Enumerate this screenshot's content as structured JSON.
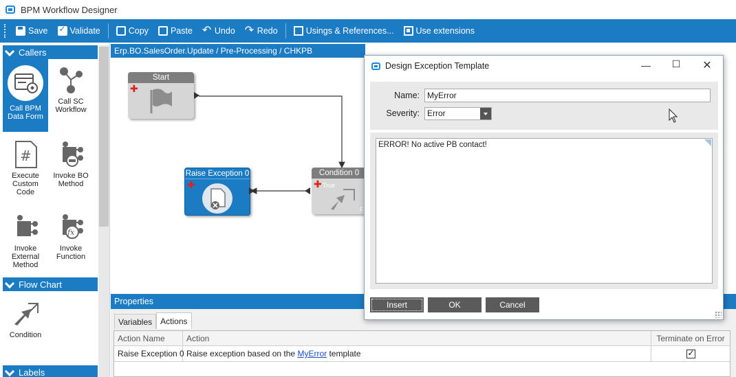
{
  "window": {
    "title": "BPM Workflow Designer"
  },
  "toolbar": {
    "save": "Save",
    "validate": "Validate",
    "copy": "Copy",
    "paste": "Paste",
    "undo": "Undo",
    "redo": "Redo",
    "usings": "Usings & References...",
    "extensions": "Use extensions"
  },
  "sidebar": {
    "callers_header": "Callers",
    "flowchart_header": "Flow Chart",
    "labels_header": "Labels",
    "tools": [
      {
        "label": "Call BPM Data Form",
        "icon": "data-form-icon"
      },
      {
        "label": "Call SC Workflow",
        "icon": "sc-workflow-icon"
      },
      {
        "label": "Execute Custom Code",
        "icon": "custom-code-icon"
      },
      {
        "label": "Invoke BO Method",
        "icon": "bo-method-icon"
      },
      {
        "label": "Invoke External Method",
        "icon": "external-method-icon"
      },
      {
        "label": "Invoke Function",
        "icon": "function-icon"
      }
    ],
    "flow_tools": [
      {
        "label": "Condition",
        "icon": "condition-icon"
      }
    ]
  },
  "canvas": {
    "breadcrumb": "Erp.BO.SalesOrder.Update / Pre-Processing / CHKPB",
    "nodes": {
      "start": "Start",
      "raise": "Raise Exception 0",
      "condition": "Condition 0",
      "condition_true": "True",
      "condition_false": "F"
    }
  },
  "properties": {
    "header": "Properties",
    "tabs": [
      "Variables",
      "Actions"
    ],
    "active_tab": "Actions",
    "columns": [
      "Action Name",
      "Action",
      "Terminate on Error"
    ],
    "rows": [
      {
        "name": "Raise Exception 0",
        "action_prefix": "Raise exception based on the",
        "action_link": "MyError",
        "action_suffix": "template",
        "terminate": true
      }
    ]
  },
  "dialog": {
    "title": "Design Exception Template",
    "name_label": "Name:",
    "name_value": "MyError",
    "severity_label": "Severity:",
    "severity_value": "Error",
    "message": "ERROR! No active PB contact!",
    "buttons": {
      "insert": "Insert",
      "ok": "OK",
      "cancel": "Cancel"
    }
  },
  "colors": {
    "accent": "#1b7bc3",
    "error": "#e0201b",
    "node_gray": "#8e8e8e"
  }
}
